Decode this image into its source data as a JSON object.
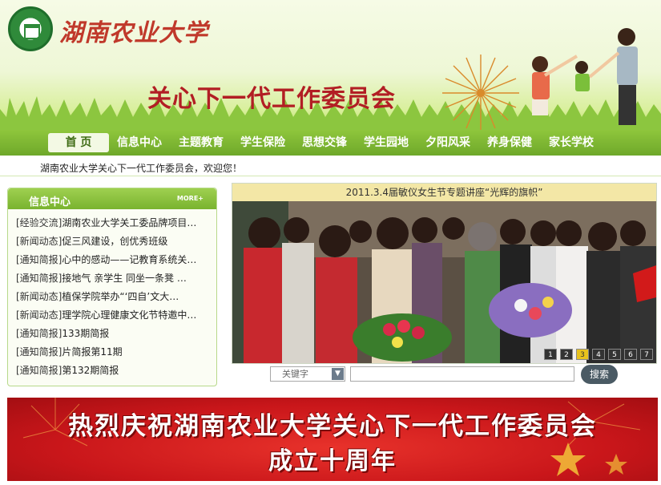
{
  "header": {
    "university_name": "湖南农业大学",
    "committee_title": "关心下一代工作委员会"
  },
  "nav": {
    "items": [
      {
        "label": "首 页",
        "active": true
      },
      {
        "label": "信息中心"
      },
      {
        "label": "主题教育"
      },
      {
        "label": "学生保险"
      },
      {
        "label": "思想交锋"
      },
      {
        "label": "学生园地"
      },
      {
        "label": "夕阳风采"
      },
      {
        "label": "养身保健"
      },
      {
        "label": "家长学校"
      }
    ]
  },
  "welcome": "湖南农业大学关心下一代工作委员会，欢迎您！",
  "info_panel": {
    "title": "信息中心",
    "more": "MORE+",
    "items": [
      {
        "category": "[经验交流]",
        "title": "湖南农业大学关工委品牌项目…"
      },
      {
        "category": "[新闻动态]",
        "title": "促三风建设，创优秀班级"
      },
      {
        "category": "[通知简报]",
        "title": "心中的感动——记教育系统关…"
      },
      {
        "category": "[通知简报]",
        "title": "接地气 亲学生 同坐一条凳 …"
      },
      {
        "category": "[新闻动态]",
        "title": "植保学院举办“‘四自’文大…"
      },
      {
        "category": "[新闻动态]",
        "title": "理学院心理健康文化节特邀中…"
      },
      {
        "category": "[通知简报]",
        "title": "133期简报"
      },
      {
        "category": "[通知简报]",
        "title": "片简报第11期"
      },
      {
        "category": "[通知简报]",
        "title": "第132期简报"
      }
    ]
  },
  "slideshow": {
    "caption": "2011.3.4届敏仪女生节专题讲座“光辉的旗帜”",
    "pages": [
      "1",
      "2",
      "3",
      "4",
      "5",
      "6",
      "7"
    ],
    "active_page": "3"
  },
  "search": {
    "select_value": "关键字",
    "input_value": "",
    "button_label": "搜索"
  },
  "banner": {
    "line1": "热烈庆祝湖南农业大学关心下一代工作委员会",
    "line2": "成立十周年"
  },
  "colors": {
    "nav_green": "#7db534",
    "title_red": "#b21e24",
    "banner_red": "#c9161a",
    "caption_yellow": "#f3e7a6"
  }
}
